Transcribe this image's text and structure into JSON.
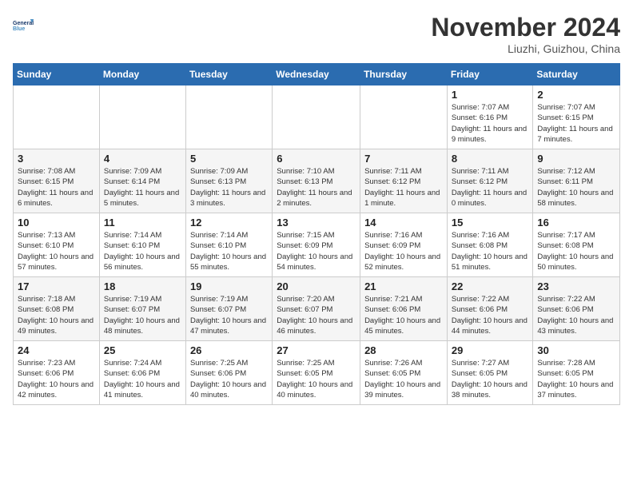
{
  "header": {
    "logo_line1": "General",
    "logo_line2": "Blue",
    "month": "November 2024",
    "location": "Liuzhi, Guizhou, China"
  },
  "weekdays": [
    "Sunday",
    "Monday",
    "Tuesday",
    "Wednesday",
    "Thursday",
    "Friday",
    "Saturday"
  ],
  "weeks": [
    [
      {
        "num": "",
        "info": ""
      },
      {
        "num": "",
        "info": ""
      },
      {
        "num": "",
        "info": ""
      },
      {
        "num": "",
        "info": ""
      },
      {
        "num": "",
        "info": ""
      },
      {
        "num": "1",
        "info": "Sunrise: 7:07 AM\nSunset: 6:16 PM\nDaylight: 11 hours and 9 minutes."
      },
      {
        "num": "2",
        "info": "Sunrise: 7:07 AM\nSunset: 6:15 PM\nDaylight: 11 hours and 7 minutes."
      }
    ],
    [
      {
        "num": "3",
        "info": "Sunrise: 7:08 AM\nSunset: 6:15 PM\nDaylight: 11 hours and 6 minutes."
      },
      {
        "num": "4",
        "info": "Sunrise: 7:09 AM\nSunset: 6:14 PM\nDaylight: 11 hours and 5 minutes."
      },
      {
        "num": "5",
        "info": "Sunrise: 7:09 AM\nSunset: 6:13 PM\nDaylight: 11 hours and 3 minutes."
      },
      {
        "num": "6",
        "info": "Sunrise: 7:10 AM\nSunset: 6:13 PM\nDaylight: 11 hours and 2 minutes."
      },
      {
        "num": "7",
        "info": "Sunrise: 7:11 AM\nSunset: 6:12 PM\nDaylight: 11 hours and 1 minute."
      },
      {
        "num": "8",
        "info": "Sunrise: 7:11 AM\nSunset: 6:12 PM\nDaylight: 11 hours and 0 minutes."
      },
      {
        "num": "9",
        "info": "Sunrise: 7:12 AM\nSunset: 6:11 PM\nDaylight: 10 hours and 58 minutes."
      }
    ],
    [
      {
        "num": "10",
        "info": "Sunrise: 7:13 AM\nSunset: 6:10 PM\nDaylight: 10 hours and 57 minutes."
      },
      {
        "num": "11",
        "info": "Sunrise: 7:14 AM\nSunset: 6:10 PM\nDaylight: 10 hours and 56 minutes."
      },
      {
        "num": "12",
        "info": "Sunrise: 7:14 AM\nSunset: 6:10 PM\nDaylight: 10 hours and 55 minutes."
      },
      {
        "num": "13",
        "info": "Sunrise: 7:15 AM\nSunset: 6:09 PM\nDaylight: 10 hours and 54 minutes."
      },
      {
        "num": "14",
        "info": "Sunrise: 7:16 AM\nSunset: 6:09 PM\nDaylight: 10 hours and 52 minutes."
      },
      {
        "num": "15",
        "info": "Sunrise: 7:16 AM\nSunset: 6:08 PM\nDaylight: 10 hours and 51 minutes."
      },
      {
        "num": "16",
        "info": "Sunrise: 7:17 AM\nSunset: 6:08 PM\nDaylight: 10 hours and 50 minutes."
      }
    ],
    [
      {
        "num": "17",
        "info": "Sunrise: 7:18 AM\nSunset: 6:08 PM\nDaylight: 10 hours and 49 minutes."
      },
      {
        "num": "18",
        "info": "Sunrise: 7:19 AM\nSunset: 6:07 PM\nDaylight: 10 hours and 48 minutes."
      },
      {
        "num": "19",
        "info": "Sunrise: 7:19 AM\nSunset: 6:07 PM\nDaylight: 10 hours and 47 minutes."
      },
      {
        "num": "20",
        "info": "Sunrise: 7:20 AM\nSunset: 6:07 PM\nDaylight: 10 hours and 46 minutes."
      },
      {
        "num": "21",
        "info": "Sunrise: 7:21 AM\nSunset: 6:06 PM\nDaylight: 10 hours and 45 minutes."
      },
      {
        "num": "22",
        "info": "Sunrise: 7:22 AM\nSunset: 6:06 PM\nDaylight: 10 hours and 44 minutes."
      },
      {
        "num": "23",
        "info": "Sunrise: 7:22 AM\nSunset: 6:06 PM\nDaylight: 10 hours and 43 minutes."
      }
    ],
    [
      {
        "num": "24",
        "info": "Sunrise: 7:23 AM\nSunset: 6:06 PM\nDaylight: 10 hours and 42 minutes."
      },
      {
        "num": "25",
        "info": "Sunrise: 7:24 AM\nSunset: 6:06 PM\nDaylight: 10 hours and 41 minutes."
      },
      {
        "num": "26",
        "info": "Sunrise: 7:25 AM\nSunset: 6:06 PM\nDaylight: 10 hours and 40 minutes."
      },
      {
        "num": "27",
        "info": "Sunrise: 7:25 AM\nSunset: 6:05 PM\nDaylight: 10 hours and 40 minutes."
      },
      {
        "num": "28",
        "info": "Sunrise: 7:26 AM\nSunset: 6:05 PM\nDaylight: 10 hours and 39 minutes."
      },
      {
        "num": "29",
        "info": "Sunrise: 7:27 AM\nSunset: 6:05 PM\nDaylight: 10 hours and 38 minutes."
      },
      {
        "num": "30",
        "info": "Sunrise: 7:28 AM\nSunset: 6:05 PM\nDaylight: 10 hours and 37 minutes."
      }
    ]
  ]
}
